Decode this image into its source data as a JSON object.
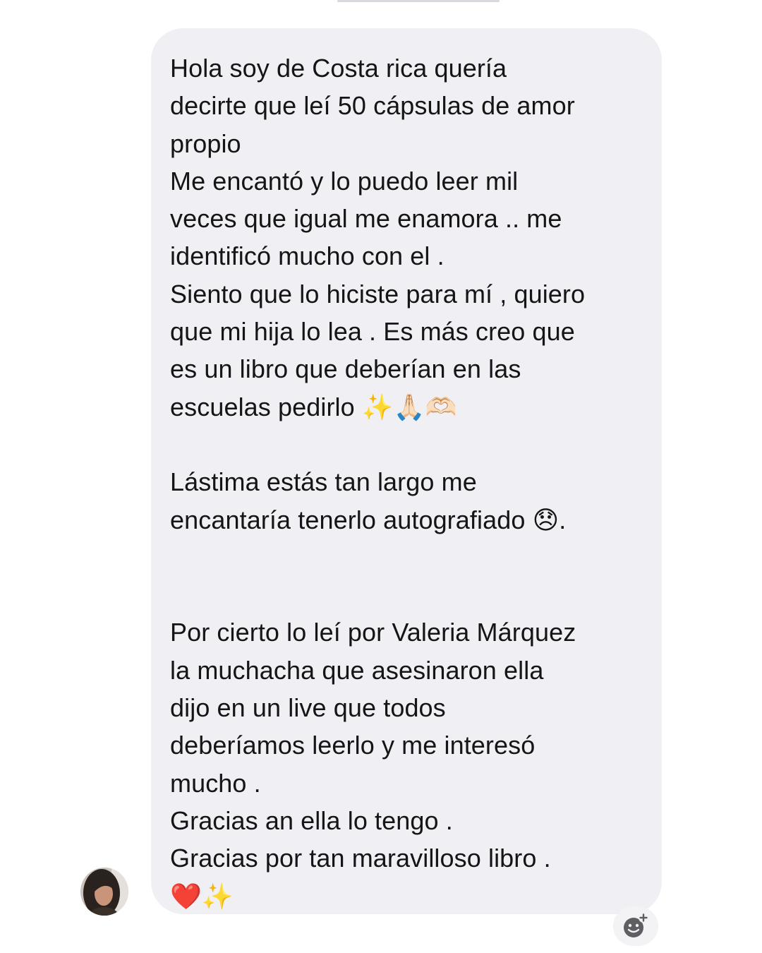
{
  "conversation": {
    "message": {
      "text": "Hola soy de Costa rica quería\ndecirte que leí 50 cápsulas de amor\npropio\nMe encantó y lo puedo leer mil\nveces que igual me enamora .. me\nidentificó mucho con el .\nSiento que lo hiciste para mí , quiero\nque mi hija lo lea . Es más creo que\nes un libro que deberían en las\nescuelas pedirlo ✨🙏🏻🫶🏻\n\nLástima estás tan largo me\nencantaría tenerlo autografiado 😞.\n\n\nPor cierto lo leí por Valeria Márquez\nla muchacha que asesinaron ella\ndijo en un live que todos\ndeberíamos leerlo y me interesó\nmucho .\nGracias an ella lo tengo .\nGracias por tan maravilloso libro .\n❤️✨"
    },
    "sender": {
      "avatar_icon": "user-avatar"
    },
    "actions": {
      "react_icon": "add-reaction-icon"
    }
  },
  "colors": {
    "bubble_background": "#efeff4",
    "text": "#151515",
    "page_background": "#ffffff",
    "react_icon": "#5e5e63"
  }
}
